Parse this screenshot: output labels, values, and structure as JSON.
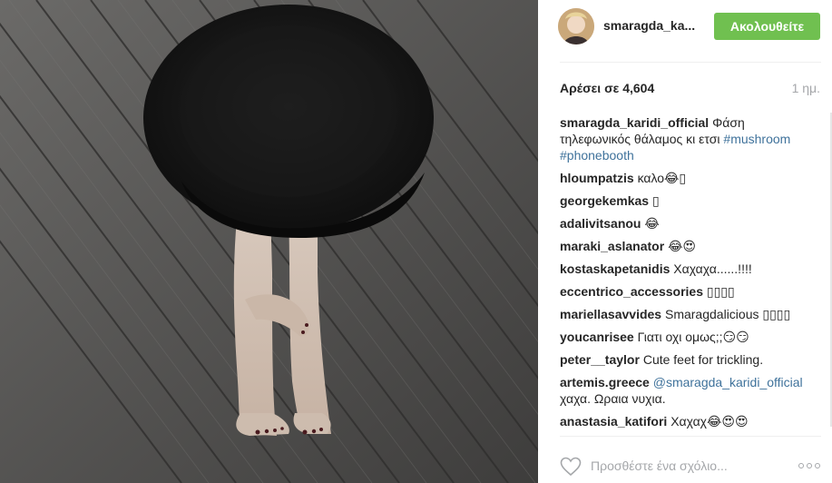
{
  "post": {
    "username": "smaragda_ka...",
    "follow_label": "Ακολουθείτε",
    "likes_text": "Αρέσει σε 4,604",
    "time": "1 ημ."
  },
  "comments": [
    {
      "user": "smaragda_karidi_official",
      "text": "Φάση τηλεφωνικός θάλαμος κι ετσι",
      "tags": "#mushroom #phonebooth"
    },
    {
      "user": "hloumpatzis",
      "text": "καλο😂▯"
    },
    {
      "user": "georgekemkas",
      "text": "▯"
    },
    {
      "user": "adalivitsanou",
      "text": "😂"
    },
    {
      "user": "maraki_aslanator",
      "text": "😂😍"
    },
    {
      "user": "kostaskapetanidis",
      "text": "Χαχαχα......!!!!"
    },
    {
      "user": "eccentrico_accessories",
      "text": "▯▯▯▯"
    },
    {
      "user": "mariellasavvides",
      "text": "Smaragdalicious ▯▯▯▯"
    },
    {
      "user": "youcanrisee",
      "text": "Γιατι οχι ομως;;😏😏"
    },
    {
      "user": "peter__taylor",
      "text": "Cute feet for trickling."
    },
    {
      "user": "artemis.greece",
      "mention": "@smaragda_karidi_official",
      "text": " χαχα. Ωραια νυχια."
    },
    {
      "user": "anastasia_katifori",
      "text": "Χαχαχ😂😍😍"
    }
  ],
  "add_comment": {
    "placeholder": "Προσθέστε ένα σχόλιο..."
  },
  "icons": {
    "like": "heart-outline-icon",
    "more": "more-options-icon"
  },
  "colors": {
    "follow_button": "#70c050",
    "hashtag": "#3f729b",
    "muted": "#a5a7aa"
  }
}
